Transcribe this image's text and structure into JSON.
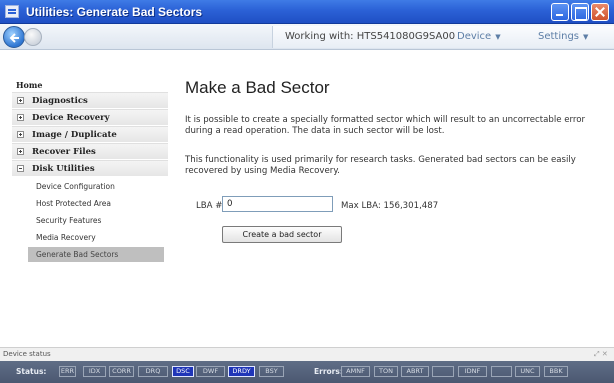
{
  "window": {
    "title": "Utilities: Generate Bad Sectors"
  },
  "toolbar": {
    "working_with": "Working with: HTS541080G9SA00",
    "device_menu": "Device",
    "settings_menu": "Settings"
  },
  "sidebar": {
    "home": "Home",
    "groups": [
      {
        "label": "Diagnostics",
        "expanded": false
      },
      {
        "label": "Device Recovery",
        "expanded": false
      },
      {
        "label": "Image / Duplicate",
        "expanded": false
      },
      {
        "label": "Recover Files",
        "expanded": false
      },
      {
        "label": "Disk Utilities",
        "expanded": true
      }
    ],
    "sub_items": [
      "Device Configuration",
      "Host Protected Area",
      "Security Features",
      "Media Recovery",
      "Generate Bad Sectors"
    ],
    "active_sub_item": "Generate Bad Sectors"
  },
  "main": {
    "title": "Make a Bad Sector",
    "paragraph1": "It is possible to create a specially formatted sector which will result to an uncorrectable error during a read operation. The data in such sector will be lost.",
    "paragraph2": "This functionality is used primarily for research tasks. Generated bad sectors can be easily recovered by using Media Recovery.",
    "lba_label": "LBA #",
    "lba_value": "0",
    "max_lba": "Max LBA: 156,301,487",
    "create_button": "Create a bad sector"
  },
  "status": {
    "device_status_label": "Device status",
    "status_label": "Status:",
    "status_flags": [
      {
        "label": "BSY",
        "on": false
      },
      {
        "label": "DRDY",
        "on": false
      },
      {
        "label": "DWF",
        "on": false
      },
      {
        "label": "DSC",
        "on": true
      },
      {
        "label": "DRQ",
        "on": false
      },
      {
        "label": "CORR",
        "on": false
      },
      {
        "label": "IDX",
        "on": false
      },
      {
        "label": "ERR",
        "on": false
      }
    ],
    "errors_label": "Errors:",
    "error_flags": [
      {
        "label": "BBK",
        "on": false
      },
      {
        "label": "UNC",
        "on": false
      },
      {
        "label": "",
        "on": false
      },
      {
        "label": "IDNF",
        "on": false
      },
      {
        "label": "",
        "on": false
      },
      {
        "label": "ABRT",
        "on": false
      },
      {
        "label": "TON",
        "on": false
      },
      {
        "label": "AMNF",
        "on": false
      }
    ],
    "colors": {
      "flag_on": "#1f35b8",
      "bar": "#56637b"
    }
  }
}
